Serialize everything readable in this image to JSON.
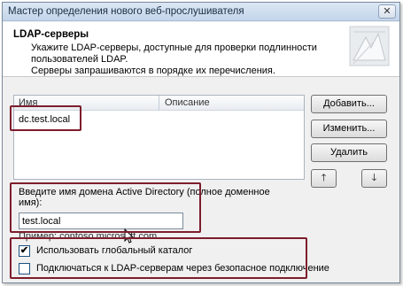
{
  "window": {
    "title": "Мастер определения нового веб-прослушивателя",
    "close_glyph": "✕"
  },
  "header": {
    "title": "LDAP-серверы",
    "description_line1": "Укажите LDAP-серверы, доступные для проверки подлинности",
    "description_line2": "пользователей LDAP.",
    "description_line3": "Серверы запрашиваются в порядке их перечисления."
  },
  "server_list": {
    "columns": [
      "Имя",
      "Описание"
    ],
    "rows": [
      {
        "name": "dc.test.local",
        "description": ""
      }
    ]
  },
  "buttons": {
    "add": "Добавить...",
    "edit": "Изменить...",
    "delete": "Удалить",
    "up": "🡑",
    "down": "🡓"
  },
  "domain": {
    "label_line1": "Введите имя домена Active Directory (полное доменное",
    "label_line2": "имя):",
    "value": "test.local",
    "example": "Пример: contoso.microsoft.com"
  },
  "options": {
    "use_global_catalog": {
      "label": "Использовать глобальный каталог",
      "checked": true
    },
    "secure_connection": {
      "label": "Подключаться к LDAP-серверам через безопасное подключение",
      "checked": false
    }
  },
  "colors": {
    "annotation": "#7d1d2c",
    "titlebar": "#c3d5ea"
  }
}
